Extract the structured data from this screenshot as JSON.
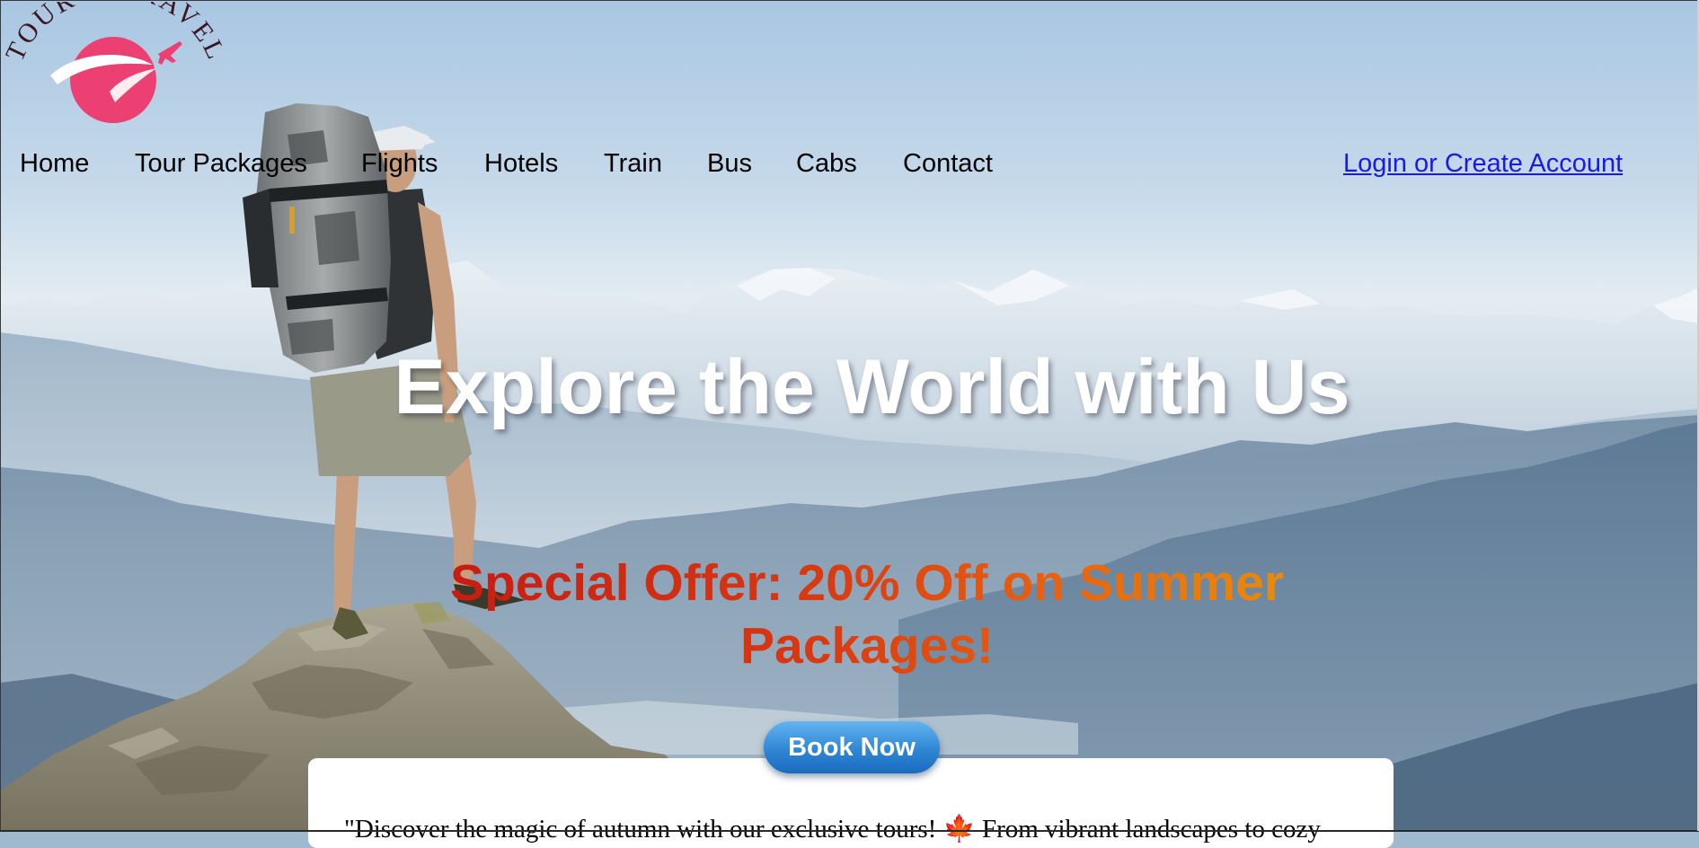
{
  "logo": {
    "text": "TOUR & TRAVEL",
    "colors": {
      "circle": "#ec3f72",
      "text": "#3a1620",
      "plane": "#ec3f72"
    }
  },
  "nav": {
    "items": [
      {
        "label": "Home"
      },
      {
        "label": "Tour Packages"
      },
      {
        "label": "Flights"
      },
      {
        "label": "Hotels"
      },
      {
        "label": "Train"
      },
      {
        "label": "Bus"
      },
      {
        "label": "Cabs"
      },
      {
        "label": "Contact"
      }
    ],
    "login_label": "Login or Create Account"
  },
  "hero": {
    "title": "Explore the World with Us",
    "offer": "Special Offer: 20% Off on Summer Packages!",
    "button_label": "Book Now"
  },
  "card": {
    "text": "\"Discover the magic of autumn with our exclusive tours! 🍁 From vibrant landscapes to cozy"
  },
  "colors": {
    "link": "#1a1ae8",
    "offer_start": "#c61a12",
    "offer_end": "#e8900c",
    "button": "#2f86d4"
  }
}
